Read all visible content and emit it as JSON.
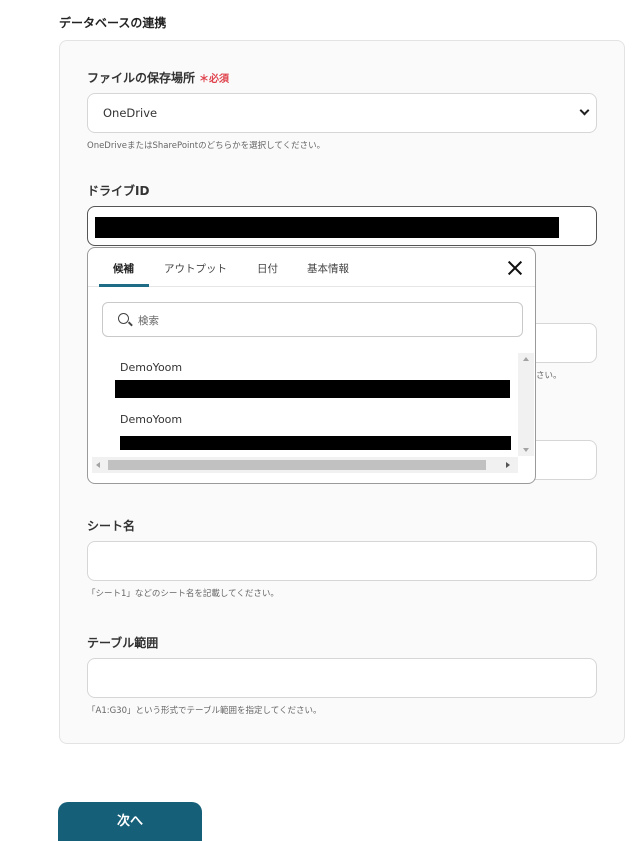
{
  "section_title": "データベースの連携",
  "file_location": {
    "label": "ファイルの保存場所",
    "required_mark": "＊必須",
    "selected": "OneDrive",
    "help": "OneDriveまたはSharePointのどちらかを選択してください。"
  },
  "drive_id": {
    "label": "ドライブID"
  },
  "popup": {
    "tabs": [
      "候補",
      "アウトプット",
      "日付",
      "基本情報"
    ],
    "search_placeholder": "検索",
    "items": [
      {
        "name": "DemoYoom"
      },
      {
        "name": "DemoYoom"
      }
    ],
    "partial_help_text": "さい。"
  },
  "sheet_name": {
    "label": "シート名",
    "help": "「シート1」などのシート名を記載してください。"
  },
  "table_range": {
    "label": "テーブル範囲",
    "help": "「A1:G30」という形式でテーブル範囲を指定してください。"
  },
  "next_button": "次へ",
  "colors": {
    "primary": "#155f78",
    "required": "#e0454f",
    "tab_underline": "#1e6c86"
  }
}
